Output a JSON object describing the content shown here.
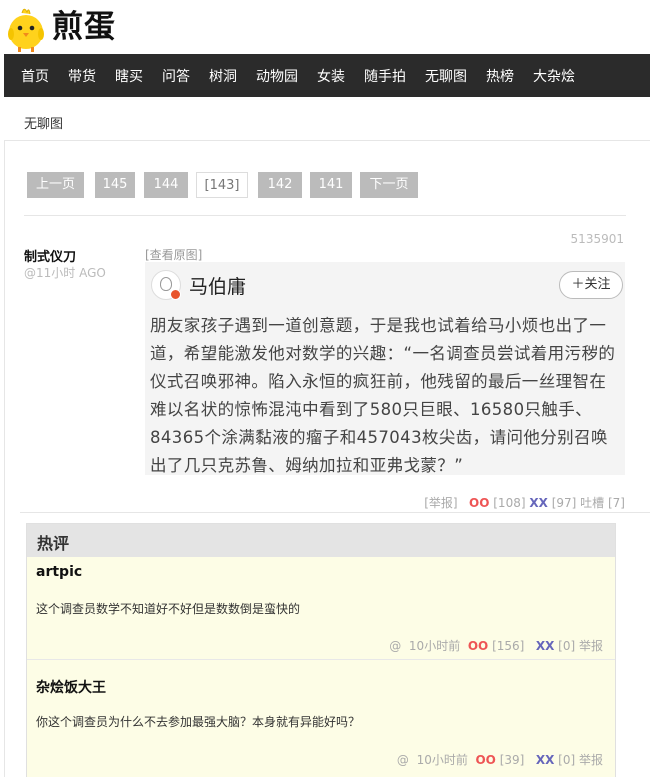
{
  "site": {
    "brand": "煎蛋",
    "logo_icon": "chick-icon"
  },
  "nav": {
    "items": [
      "首页",
      "带货",
      "瞎买",
      "问答",
      "树洞",
      "动物园",
      "女装",
      "随手拍",
      "无聊图",
      "热榜",
      "大杂烩"
    ]
  },
  "breadcrumb": "无聊图",
  "pager": {
    "prev": "上一页",
    "pages": [
      "145",
      "144",
      "[143]",
      "142",
      "141"
    ],
    "next": "下一页",
    "current": "143"
  },
  "post": {
    "author": "制式仪刀",
    "ago": "@11小时 AGO",
    "id": "5135901",
    "view_original": "[查看原图]",
    "card": {
      "name": "马伯庸",
      "follow": "＋关注",
      "text": "朋友家孩子遇到一道创意题，于是我也试着给马小烦也出了一道，希望能激发他对数学的兴趣：“一名调查员尝试着用污秽的仪式召唤邪神。陷入永恒的疯狂前，他残留的最后一丝理智在难以名状的惊怖混沌中看到了580只巨眼、16580只触手、84365个涂满黏液的瘤子和457043枚尖齿，请问他分别召唤出了几只克苏鲁、姆纳加拉和亚弗戈蒙？”"
    },
    "actions": {
      "report": "[举报]",
      "oo": "OO",
      "oo_count": "[108]",
      "xx": "XX",
      "xx_count": "[97]",
      "tucao": "吐槽 [7]"
    }
  },
  "hot": {
    "title": "热评",
    "comments": [
      {
        "author": "artpic",
        "text": "这个调查员数学不知道好不好但是数数倒是蛮快的",
        "at": "@",
        "time": "10小时前",
        "oo": "OO",
        "oo_count": "[156]",
        "xx": "XX",
        "xx_count": "[0]",
        "report": "举报"
      },
      {
        "author": "杂烩饭大王",
        "text": "你这个调查员为什么不去参加最强大脑？本身就有异能好吗？",
        "at": "@",
        "time": "10小时前",
        "oo": "OO",
        "oo_count": "[39]",
        "xx": "XX",
        "xx_count": "[0]",
        "report": "举报"
      }
    ]
  },
  "colors": {
    "nav_bg": "#2b2b2b",
    "pager_bg": "#bbbbbb",
    "hot_bg": "#fdfde6",
    "oo": "#ee5555",
    "xx": "#6666bb"
  }
}
